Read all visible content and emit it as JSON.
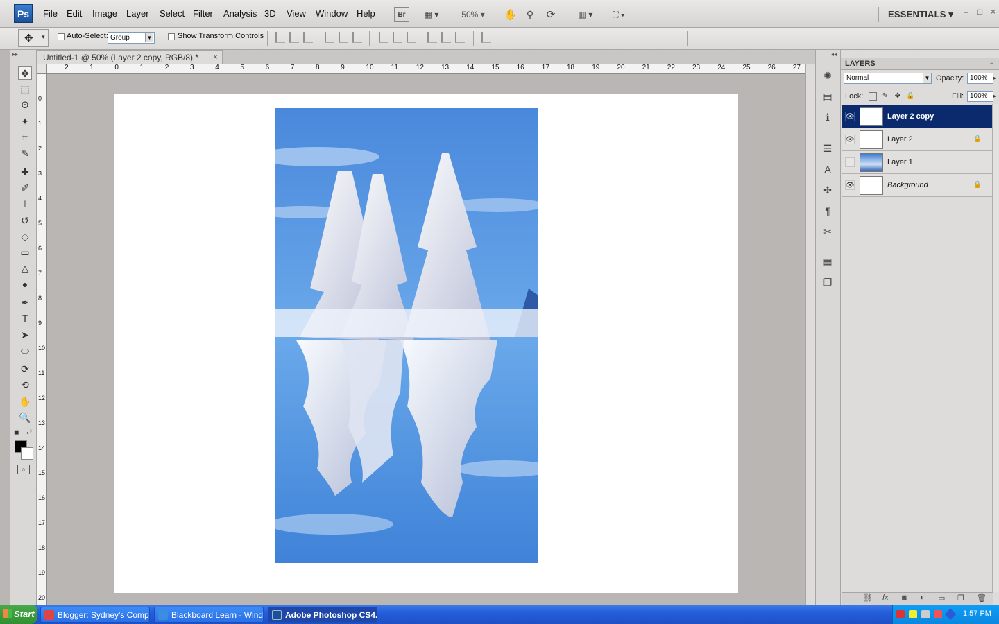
{
  "app": {
    "logo": "Ps"
  },
  "menubar": {
    "items": [
      "File",
      "Edit",
      "Image",
      "Layer",
      "Select",
      "Filter",
      "Analysis",
      "3D",
      "View",
      "Window",
      "Help"
    ],
    "bridge": "Br",
    "zoom": "50%",
    "workspace": "ESSENTIALS",
    "win_minimize": "–",
    "win_restore": "□",
    "win_close": "×"
  },
  "options": {
    "auto_select_label": "Auto-Select:",
    "auto_select_checked": false,
    "auto_select_target": "Group",
    "show_transform_label": "Show Transform Controls",
    "show_transform_checked": false
  },
  "document": {
    "tab_title": "Untitled-1 @ 50% (Layer 2 copy, RGB/8) *",
    "tab_close": "×",
    "ruler_h": [
      "2",
      "1",
      "0",
      "1",
      "2",
      "3",
      "4",
      "5",
      "6",
      "7",
      "8",
      "9",
      "10",
      "11",
      "12",
      "13",
      "14",
      "15",
      "16",
      "17",
      "18",
      "19",
      "20",
      "21",
      "22",
      "23",
      "24",
      "25",
      "26",
      "27"
    ],
    "ruler_v": [
      "0",
      "1",
      "2",
      "3",
      "4",
      "5",
      "6",
      "7",
      "8",
      "9",
      "10",
      "11",
      "12",
      "13",
      "14",
      "15",
      "16",
      "17",
      "18",
      "19",
      "20"
    ]
  },
  "tools": [
    {
      "name": "move-tool-icon",
      "glyph": "✥"
    },
    {
      "name": "marquee-tool-icon",
      "glyph": "⬚"
    },
    {
      "name": "lasso-tool-icon",
      "glyph": "ʘ"
    },
    {
      "name": "magic-wand-tool-icon",
      "glyph": "✦"
    },
    {
      "name": "crop-tool-icon",
      "glyph": "⌗"
    },
    {
      "name": "eyedropper-tool-icon",
      "glyph": "✎"
    },
    {
      "name": "healing-brush-tool-icon",
      "glyph": "✚"
    },
    {
      "name": "brush-tool-icon",
      "glyph": "✐"
    },
    {
      "name": "clone-stamp-tool-icon",
      "glyph": "⊥"
    },
    {
      "name": "history-brush-tool-icon",
      "glyph": "↺"
    },
    {
      "name": "eraser-tool-icon",
      "glyph": "◇"
    },
    {
      "name": "gradient-tool-icon",
      "glyph": "▭"
    },
    {
      "name": "blur-tool-icon",
      "glyph": "△"
    },
    {
      "name": "dodge-tool-icon",
      "glyph": "●"
    },
    {
      "name": "pen-tool-icon",
      "glyph": "✒"
    },
    {
      "name": "type-tool-icon",
      "glyph": "T"
    },
    {
      "name": "path-selection-tool-icon",
      "glyph": "➤"
    },
    {
      "name": "ellipse-tool-icon",
      "glyph": "⬭"
    },
    {
      "name": "3d-rotate-tool-icon",
      "glyph": "⟳"
    },
    {
      "name": "3d-orbit-tool-icon",
      "glyph": "⟲"
    },
    {
      "name": "hand-tool-icon",
      "glyph": "✋"
    },
    {
      "name": "zoom-tool-icon",
      "glyph": "🔍"
    }
  ],
  "dock_icons": [
    "navigator-icon",
    "histogram-icon",
    "info-icon",
    "history-icon",
    "character-icon",
    "brushes-icon",
    "paragraph-icon",
    "tool-presets-icon",
    "layer-comps-icon",
    "clone-source-icon"
  ],
  "layers_panel": {
    "title": "LAYERS",
    "blend_mode": "Normal",
    "opacity_label": "Opacity:",
    "opacity": "100%",
    "lock_label": "Lock:",
    "fill_label": "Fill:",
    "fill": "100%",
    "layers": [
      {
        "name": "Layer 2 copy",
        "visible": true,
        "selected": true,
        "locked": false,
        "thumb": "checker-photo"
      },
      {
        "name": "Layer 2",
        "visible": true,
        "selected": false,
        "locked": true,
        "thumb": "checker-photo"
      },
      {
        "name": "Layer 1",
        "visible": false,
        "selected": false,
        "locked": false,
        "thumb": "photo"
      },
      {
        "name": "Background",
        "visible": true,
        "selected": false,
        "locked": true,
        "thumb": "white"
      }
    ]
  },
  "taskbar": {
    "start_label": "Start",
    "tasks": [
      {
        "label": "Blogger: Sydney's Comp...",
        "active": false,
        "icon_color": "#d44"
      },
      {
        "label": "Blackboard Learn - Wind...",
        "active": false,
        "icon_color": "#3a8de0"
      },
      {
        "label": "Adobe Photoshop CS4...",
        "active": true,
        "icon_color": "#1d4f9a"
      }
    ],
    "clock": "1:57 PM"
  },
  "colors": {
    "accent": "#0b2a6e",
    "canvas_bg": "#b9b6b4",
    "sky": "#4a8fe0"
  }
}
